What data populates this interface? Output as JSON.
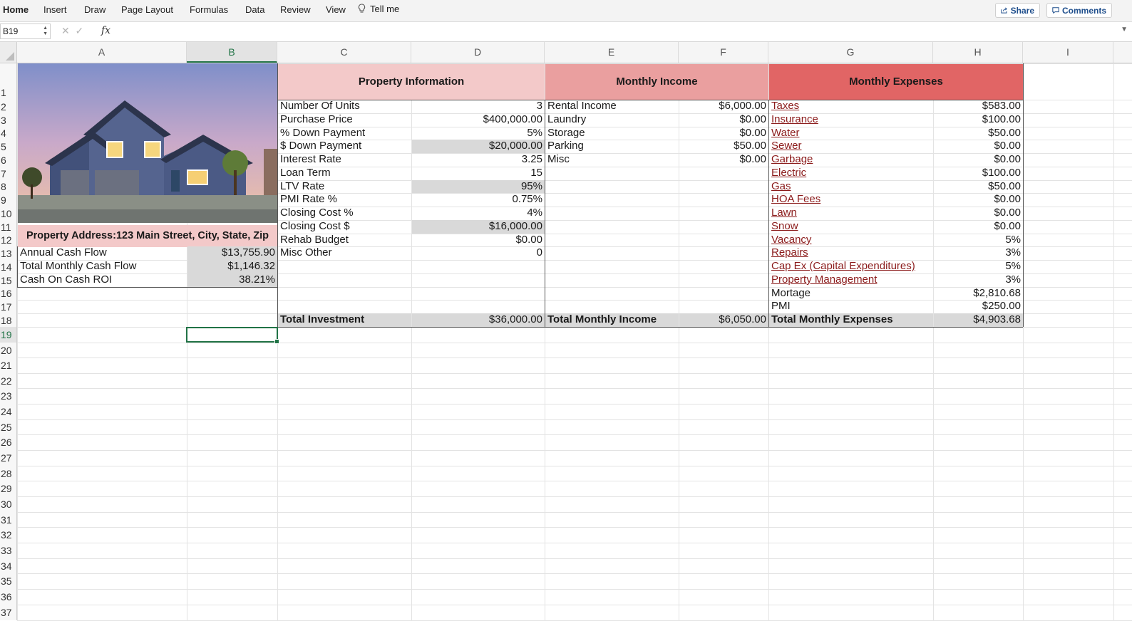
{
  "ribbon": {
    "tabs": [
      "Home",
      "Insert",
      "Draw",
      "Page Layout",
      "Formulas",
      "Data",
      "Review",
      "View"
    ],
    "tell_me": "Tell me",
    "share": "Share",
    "comments": "Comments"
  },
  "formula_bar": {
    "name_box": "B19",
    "fx": "fx",
    "value": ""
  },
  "columns": [
    "A",
    "B",
    "C",
    "D",
    "E",
    "F",
    "G",
    "H",
    "I"
  ],
  "rows": [
    "1",
    "2",
    "3",
    "4",
    "5",
    "6",
    "7",
    "8",
    "9",
    "10",
    "11",
    "12",
    "13",
    "14",
    "15",
    "16",
    "17",
    "18",
    "19",
    "20",
    "21",
    "22",
    "23",
    "24",
    "25",
    "26",
    "27",
    "28",
    "29",
    "30",
    "31",
    "32",
    "33",
    "34",
    "35",
    "36",
    "37"
  ],
  "headers": {
    "property": "Property Information",
    "income": "Monthly Income",
    "expenses": "Monthly Expenses"
  },
  "address": "Property Address:123 Main Street, City, State, Zip",
  "summary": [
    {
      "label": "Annual Cash Flow",
      "value": "$13,755.90"
    },
    {
      "label": "Total Monthly Cash Flow",
      "value": "$1,146.32"
    },
    {
      "label": "Cash On Cash ROI",
      "value": "38.21%"
    }
  ],
  "property": [
    {
      "label": "Number Of Units",
      "value": "3"
    },
    {
      "label": "Purchase Price",
      "value": "$400,000.00"
    },
    {
      "label": "% Down Payment",
      "value": "5%"
    },
    {
      "label": "$ Down Payment",
      "value": "$20,000.00"
    },
    {
      "label": "Interest Rate",
      "value": "3.25"
    },
    {
      "label": "Loan Term",
      "value": "15"
    },
    {
      "label": "LTV Rate",
      "value": "95%"
    },
    {
      "label": "PMI Rate %",
      "value": "0.75%"
    },
    {
      "label": "Closing Cost %",
      "value": "4%"
    },
    {
      "label": "Closing Cost $",
      "value": "$16,000.00"
    },
    {
      "label": "Rehab Budget",
      "value": "$0.00"
    },
    {
      "label": "Misc Other",
      "value": "0"
    }
  ],
  "income": [
    {
      "label": "Rental Income",
      "value": "$6,000.00"
    },
    {
      "label": "Laundry",
      "value": "$0.00"
    },
    {
      "label": "Storage",
      "value": "$0.00"
    },
    {
      "label": "Parking",
      "value": "$50.00"
    },
    {
      "label": "Misc",
      "value": "$0.00"
    }
  ],
  "expenses": [
    {
      "label": "Taxes",
      "value": "$583.00"
    },
    {
      "label": "Insurance",
      "value": "$100.00"
    },
    {
      "label": "Water",
      "value": "$50.00"
    },
    {
      "label": "Sewer",
      "value": "$0.00"
    },
    {
      "label": "Garbage",
      "value": "$0.00"
    },
    {
      "label": "Electric",
      "value": "$100.00"
    },
    {
      "label": "Gas",
      "value": "$50.00"
    },
    {
      "label": "HOA Fees",
      "value": "$0.00"
    },
    {
      "label": "Lawn",
      "value": "$0.00"
    },
    {
      "label": "Snow",
      "value": "$0.00"
    },
    {
      "label": "Vacancy",
      "value": "5%"
    },
    {
      "label": "Repairs",
      "value": "3%"
    },
    {
      "label": "Cap Ex (Capital Expenditures)",
      "value": "5%"
    },
    {
      "label": "Property Management",
      "value": "3%"
    },
    {
      "label": "Mortage",
      "value": "$2,810.68"
    },
    {
      "label": "PMI",
      "value": "$250.00"
    }
  ],
  "totals": {
    "investment_label": "Total Investment",
    "investment": "$36,000.00",
    "income_label": "Total Monthly Income",
    "income": "$6,050.00",
    "expenses_label": "Total Monthly Expenses",
    "expenses": "$4,903.68"
  },
  "colors": {
    "accent": "#217346",
    "header1": "#f3c9c9",
    "header2": "#ea9f9f",
    "header3": "#e16565",
    "link": "#8b1b1b"
  }
}
